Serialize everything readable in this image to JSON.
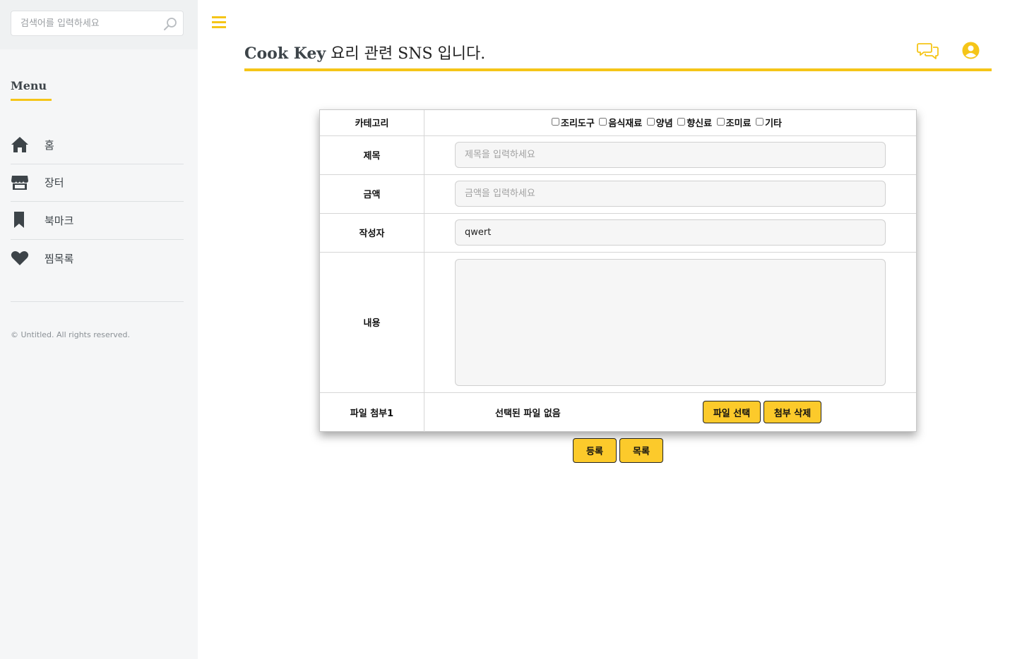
{
  "sidebar": {
    "search_placeholder": "검색어를 입력하세요",
    "menu_title": "Menu",
    "items": [
      {
        "label": "홈",
        "icon": "home-icon"
      },
      {
        "label": "장터",
        "icon": "store-icon"
      },
      {
        "label": "북마크",
        "icon": "bookmark-icon"
      },
      {
        "label": "찜목록",
        "icon": "heart-icon"
      }
    ],
    "copyright": "© Untitled. All rights reserved."
  },
  "header": {
    "brand": "Cook Key",
    "tagline": " 요리 관련 SNS 입니다."
  },
  "form": {
    "category_label": "카테고리",
    "categories": [
      "조리도구",
      "음식재료",
      "양념",
      "향신료",
      "조미료",
      "기타"
    ],
    "title_label": "제목",
    "title_placeholder": "제목을 입력하세요",
    "price_label": "금액",
    "price_placeholder": "금액을 입력하세요",
    "writer_label": "작성자",
    "writer_value": "qwert",
    "content_label": "내용",
    "file_label": "파일 첨부1",
    "file_status": "선택된 파일 없음",
    "file_select_button": "파일 선택",
    "file_remove_button": "첨부 삭제"
  },
  "actions": {
    "submit_button": "등록",
    "list_button": "목록"
  },
  "colors": {
    "accent": "#f5c518",
    "button": "#fcca2b",
    "sidebar_bg": "#f5f6f7",
    "text": "#3d4449"
  }
}
